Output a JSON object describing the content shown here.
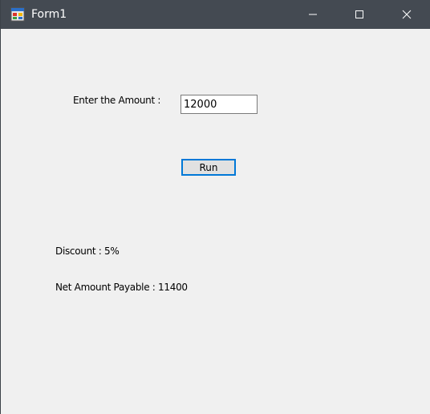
{
  "window": {
    "title": "Form1",
    "icon": "winforms-app-icon",
    "controls": [
      "minimize-icon",
      "maximize-icon",
      "close-icon"
    ],
    "titlebar_color": "#444a52",
    "background_color": "#f0f0f0",
    "accent_color": "#0078d7"
  },
  "form": {
    "amount_label": "Enter the Amount :",
    "amount_value": "12000",
    "run_label": "Run",
    "discount_text": "Discount : 5%",
    "net_amount_text": "Net Amount Payable :  11400"
  }
}
